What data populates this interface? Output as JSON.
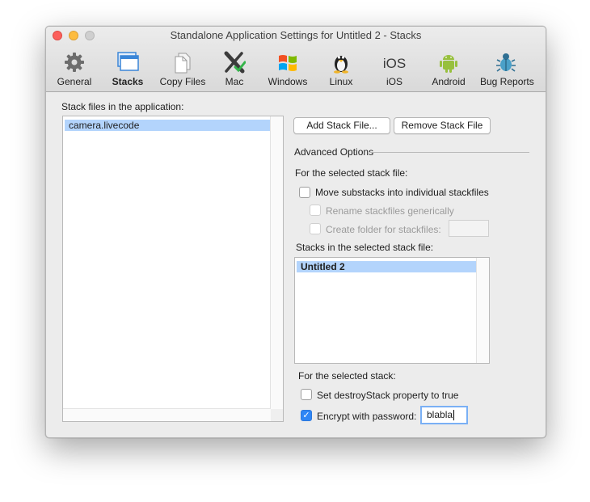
{
  "window": {
    "title": "Standalone Application Settings for Untitled 2 - Stacks"
  },
  "toolbar": {
    "items": [
      {
        "label": "General",
        "icon": "gear-icon"
      },
      {
        "label": "Stacks",
        "icon": "stacks-icon",
        "active": true
      },
      {
        "label": "Copy Files",
        "icon": "copy-files-icon"
      },
      {
        "label": "Mac",
        "icon": "mac-x-icon"
      },
      {
        "label": "Windows",
        "icon": "windows-icon"
      },
      {
        "label": "Linux",
        "icon": "linux-penguin-icon"
      },
      {
        "label": "iOS",
        "icon": "ios-icon"
      },
      {
        "label": "Android",
        "icon": "android-icon"
      },
      {
        "label": "Bug Reports",
        "icon": "bug-icon"
      }
    ]
  },
  "stack_files": {
    "label": "Stack files in the application:",
    "items": [
      "camera.livecode"
    ],
    "selected": "camera.livecode"
  },
  "buttons": {
    "add_stack_file": "Add Stack File...",
    "remove_stack_file": "Remove Stack File"
  },
  "advanced": {
    "heading": "Advanced Options",
    "for_stack_file": "For the selected stack file:",
    "move_substacks": "Move substacks into individual stackfiles",
    "rename_generically": "Rename stackfiles generically",
    "create_folder": "Create folder for stackfiles:",
    "folder_name_value": "",
    "stacks_label": "Stacks in the selected stack file:",
    "stacks": [
      "Untitled 2"
    ],
    "for_stack": "For the selected stack:",
    "destroy_stack": "Set destroyStack property to true",
    "encrypt": "Encrypt with password:",
    "password_value": "blabla",
    "move_substacks_checked": false,
    "rename_generically_checked": false,
    "create_folder_checked": false,
    "destroy_stack_checked": false,
    "encrypt_checked": true
  },
  "colors": {
    "selection": "#b3d4fc",
    "checkbox_accent": "#2f86f5",
    "focus_ring": "#7ab0f5"
  }
}
